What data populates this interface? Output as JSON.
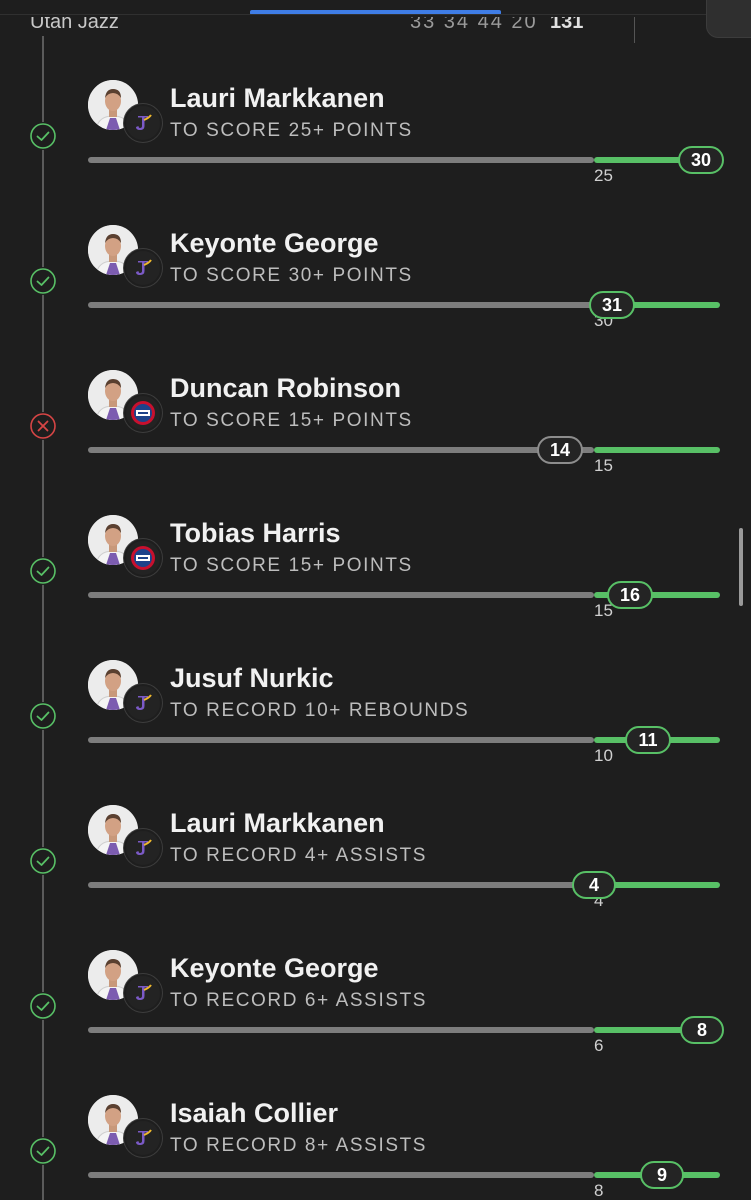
{
  "header": {
    "team_name": "Utah Jazz",
    "quarter_scores": "33  34  44  20",
    "total_score": "131"
  },
  "colors": {
    "background": "#1e1e1e",
    "accent_blue": "#3f7de6",
    "hit_green": "#58c066",
    "miss_red": "#d64545",
    "track_gray": "#7d7d7d"
  },
  "picks": [
    {
      "player": "Lauri Markkanen",
      "prop": "TO SCORE 25+ POINTS",
      "line": "25",
      "result": "30",
      "status": "hit",
      "team": "Utah Jazz",
      "team_icon": "jazz-logo-icon"
    },
    {
      "player": "Keyonte George",
      "prop": "TO SCORE 30+ POINTS",
      "line": "30",
      "result": "31",
      "status": "hit",
      "team": "Utah Jazz",
      "team_icon": "jazz-logo-icon"
    },
    {
      "player": "Duncan Robinson",
      "prop": "TO SCORE 15+ POINTS",
      "line": "15",
      "result": "14",
      "status": "miss",
      "team": "Detroit Pistons",
      "team_icon": "pistons-logo-icon"
    },
    {
      "player": "Tobias Harris",
      "prop": "TO SCORE 15+ POINTS",
      "line": "15",
      "result": "16",
      "status": "hit",
      "team": "Detroit Pistons",
      "team_icon": "pistons-logo-icon"
    },
    {
      "player": "Jusuf Nurkic",
      "prop": "TO RECORD 10+ REBOUNDS",
      "line": "10",
      "result": "11",
      "status": "hit",
      "team": "Utah Jazz",
      "team_icon": "jazz-logo-icon"
    },
    {
      "player": "Lauri Markkanen",
      "prop": "TO RECORD 4+ ASSISTS",
      "line": "4",
      "result": "4",
      "status": "hit",
      "team": "Utah Jazz",
      "team_icon": "jazz-logo-icon"
    },
    {
      "player": "Keyonte George",
      "prop": "TO RECORD 6+ ASSISTS",
      "line": "6",
      "result": "8",
      "status": "hit",
      "team": "Utah Jazz",
      "team_icon": "jazz-logo-icon"
    },
    {
      "player": "Isaiah Collier",
      "prop": "TO RECORD 8+ ASSISTS",
      "line": "8",
      "result": "9",
      "status": "hit",
      "team": "Utah Jazz",
      "team_icon": "jazz-logo-icon"
    }
  ]
}
